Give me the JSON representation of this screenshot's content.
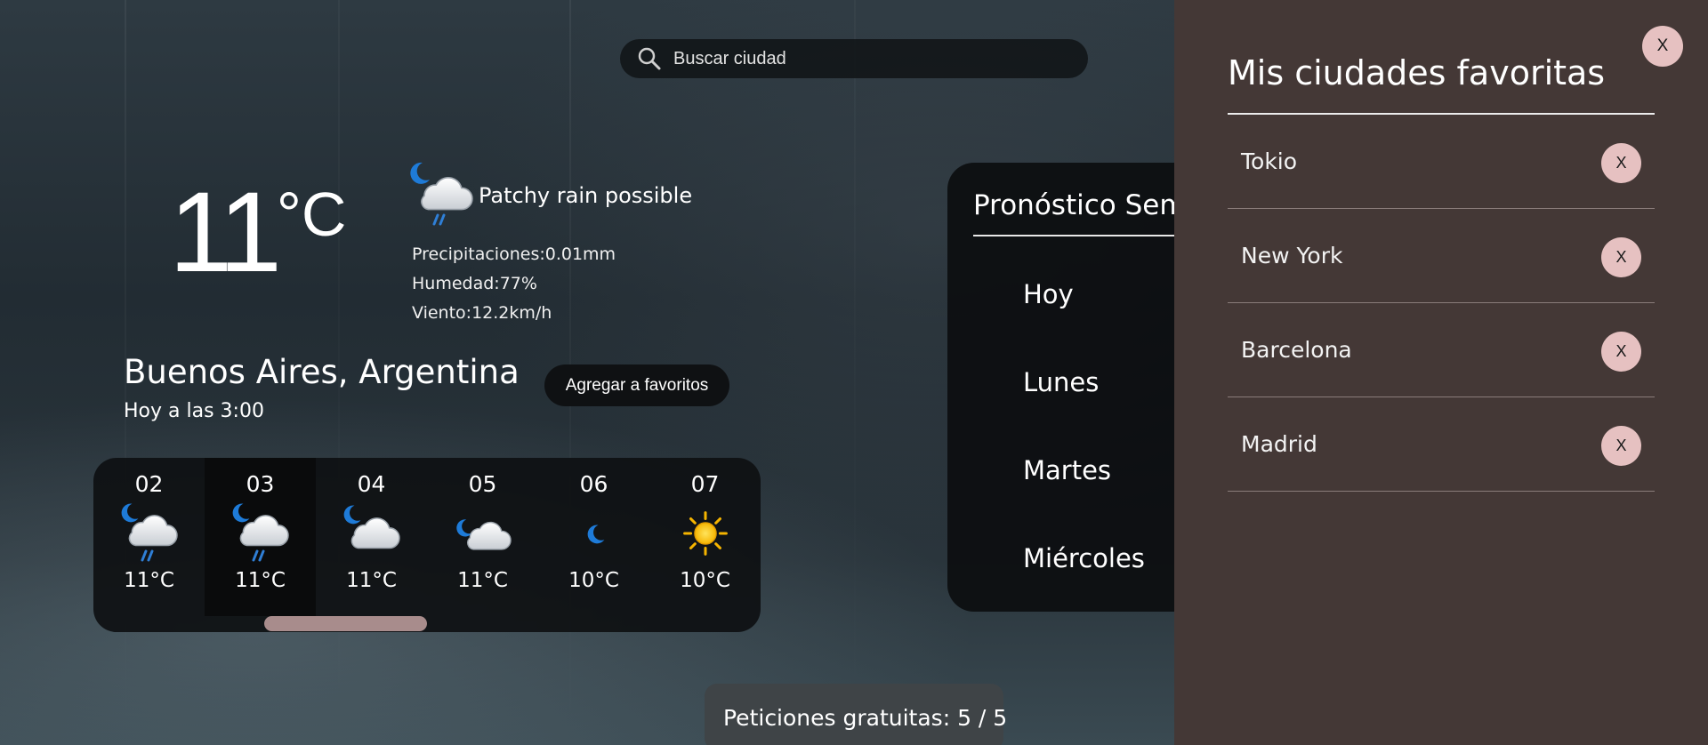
{
  "search": {
    "placeholder": "Buscar ciudad",
    "value": "",
    "icon": "search-icon"
  },
  "current": {
    "temperature": "11",
    "unit": "°C",
    "condition": "Patchy rain possible",
    "condition_icon": "night-cloud-rain-icon",
    "precipitation": "Precipitaciones:0.01mm",
    "humidity": "Humedad:77%",
    "wind": "Viento:12.2km/h",
    "location": "Buenos Aires, Argentina",
    "date_time": "Hoy a las 3:00",
    "add_favorite_label": "Agregar a favoritos"
  },
  "hourly": [
    {
      "hour": "02",
      "temp": "11°C",
      "icon": "night-cloud-rain-icon"
    },
    {
      "hour": "03",
      "temp": "11°C",
      "icon": "night-cloud-rain-icon"
    },
    {
      "hour": "04",
      "temp": "11°C",
      "icon": "night-cloud-icon"
    },
    {
      "hour": "05",
      "temp": "11°C",
      "icon": "night-cloud-small-icon"
    },
    {
      "hour": "06",
      "temp": "10°C",
      "icon": "moon-icon"
    },
    {
      "hour": "07",
      "temp": "10°C",
      "icon": "sun-icon"
    }
  ],
  "weekly": {
    "title": "Pronóstico Sem",
    "days": [
      "Hoy",
      "Lunes",
      "Martes",
      "Miércoles"
    ]
  },
  "favorites_panel": {
    "title": "Mis ciudades favoritas",
    "close_label": "X",
    "cities": [
      {
        "name": "Tokio",
        "remove_label": "X"
      },
      {
        "name": "New York",
        "remove_label": "X"
      },
      {
        "name": "Barcelona",
        "remove_label": "X"
      },
      {
        "name": "Madrid",
        "remove_label": "X"
      }
    ]
  },
  "requests_badge": "Peticiones gratuitas: 5 / 5",
  "colors": {
    "panel_bg": "#443836",
    "pill_button": "#e6c1c1",
    "scroll_thumb": "#a88c8c",
    "dark_card": "#0e1012"
  }
}
